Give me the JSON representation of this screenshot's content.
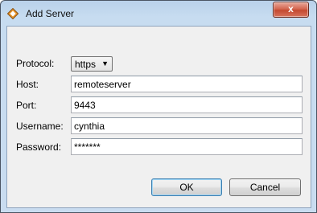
{
  "window": {
    "title": "Add Server",
    "close_glyph": "x"
  },
  "form": {
    "protocol_label": "Protocol:",
    "protocol_value": "https",
    "host_label": "Host:",
    "host_value": "remoteserver",
    "port_label": "Port:",
    "port_value": "9443",
    "username_label": "Username:",
    "username_value": "cynthia",
    "password_label": "Password:",
    "password_value": "*******"
  },
  "buttons": {
    "ok": "OK",
    "cancel": "Cancel"
  },
  "icons": {
    "app": "diamond-app-icon",
    "dropdown": "chevron-down-icon",
    "close": "close-icon"
  },
  "colors": {
    "title_bar": "#c3d8ee",
    "dialog_bg": "#f0f0f0",
    "close_button": "#c94a31",
    "default_button_border": "#3c7fb1"
  }
}
